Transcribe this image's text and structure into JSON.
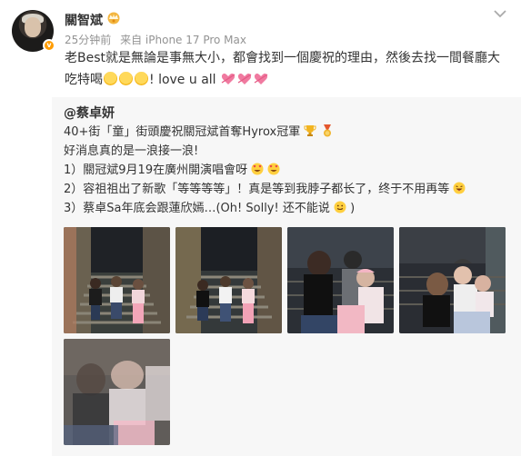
{
  "post": {
    "username": "關智斌",
    "time": "25分钟前",
    "source": "来自 iPhone 17 Pro Max",
    "text_part1": "老Best就是無論是事無大小，都會找到一個慶祝的理由，然後去找一間餐廳大吃特",
    "text_part2": "喝",
    "text_part3": "! love u all"
  },
  "repost": {
    "user": "@蔡卓妍",
    "line1": "40+街「童」街頭慶祝關冠斌首奪Hyrox冠軍",
    "line2": "好消息真的是一浪接一浪!",
    "line3": "1）關冠斌9月19在廣州開演唱會呀",
    "line4": "2）容祖祖出了新歌「等等等等」！真是等到我脖子都长了，终于不用再等",
    "line5": "3）蔡卓Sa年底会跟蓮欣嫣…(Oh! Solly! 还不能说"
  },
  "colors": {
    "username": "#333333",
    "meta": "#939393",
    "verified_badge": "#ff9c00",
    "repost_bg": "#f7f7f7"
  },
  "icons": {
    "verified": "verified-badge-icon",
    "vip": "vip-crown-icon",
    "more": "chevron-down-icon",
    "laugh": "laughing-emoji-icon",
    "heart": "heart-emoji-icon",
    "trophy": "trophy-emoji-icon",
    "medal": "medal-emoji-icon",
    "heart_eyes": "heart-eyes-emoji-icon",
    "smile": "grinning-emoji-icon"
  }
}
